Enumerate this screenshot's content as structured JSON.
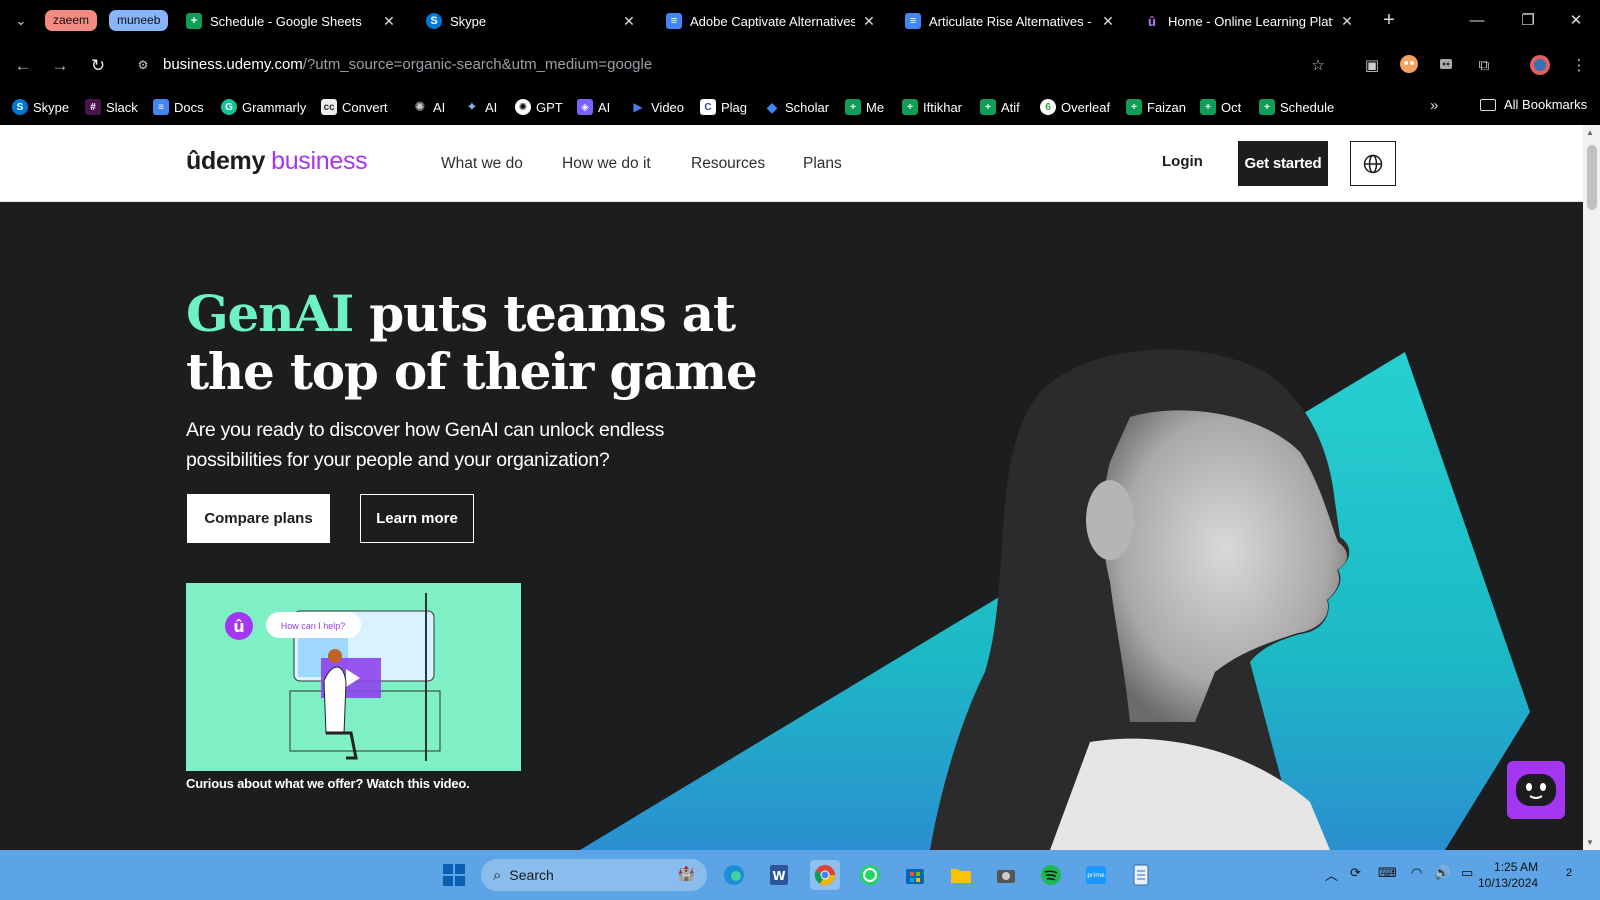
{
  "browser": {
    "tab_groups": [
      {
        "label": "zaeem",
        "color": "#f28b82"
      },
      {
        "label": "muneeb",
        "color": "#8ab4f8"
      }
    ],
    "tabs": [
      {
        "title": "Schedule - Google Sheets",
        "icon": "google-sheets-icon"
      },
      {
        "title": "Skype",
        "icon": "skype-icon"
      },
      {
        "title": "Adobe Captivate Alternatives",
        "icon": "google-docs-icon"
      },
      {
        "title": "Articulate Rise Alternatives - G",
        "icon": "google-docs-icon"
      },
      {
        "title": "Home - Online Learning Platfo",
        "icon": "udemy-icon"
      }
    ],
    "url_host": "business.udemy.com",
    "url_rest": "/?utm_source=organic-search&utm_medium=google",
    "bookmarks": [
      {
        "label": "Skype",
        "icon": "skype-icon"
      },
      {
        "label": "Slack",
        "icon": "slack-icon"
      },
      {
        "label": "Docs",
        "icon": "google-docs-icon"
      },
      {
        "label": "Grammarly",
        "icon": "grammarly-icon"
      },
      {
        "label": "Convert",
        "icon": "convert-icon"
      },
      {
        "label": "AI",
        "icon": "openai-icon"
      },
      {
        "label": "AI",
        "icon": "gemini-icon"
      },
      {
        "label": "GPT",
        "icon": "chatgpt-icon"
      },
      {
        "label": "AI",
        "icon": "ai-assistant-icon"
      },
      {
        "label": "Video",
        "icon": "video-icon"
      },
      {
        "label": "Plag",
        "icon": "plagiarism-icon"
      },
      {
        "label": "Scholar",
        "icon": "google-scholar-icon"
      },
      {
        "label": "Me",
        "icon": "google-sheets-icon"
      },
      {
        "label": "Iftikhar",
        "icon": "google-sheets-icon"
      },
      {
        "label": "Atif",
        "icon": "google-sheets-icon"
      },
      {
        "label": "Overleaf",
        "icon": "overleaf-icon"
      },
      {
        "label": "Faizan",
        "icon": "google-sheets-icon"
      },
      {
        "label": "Oct",
        "icon": "google-sheets-icon"
      },
      {
        "label": "Schedule",
        "icon": "google-sheets-icon"
      }
    ],
    "all_bookmarks": "All Bookmarks"
  },
  "site": {
    "logo_udemy": "ûdemy",
    "logo_business": "business",
    "nav": [
      "What we do",
      "How we do it",
      "Resources",
      "Plans"
    ],
    "login": "Login",
    "get_started": "Get started"
  },
  "hero": {
    "title_accent": "GenAI",
    "title_line1_rest": " puts teams at",
    "title_line2": "the top of their game",
    "subtitle": "Are you ready to discover how GenAI can unlock endless possibilities for your people and your organization?",
    "btn_compare": "Compare plans",
    "btn_learn": "Learn more",
    "video_bubble": "How can I help?",
    "video_caption": "Curious about what we offer? Watch this video."
  },
  "taskbar": {
    "search_label": "Search",
    "time": "1:25 AM",
    "date": "10/13/2024",
    "notification_count": "2"
  },
  "colors": {
    "accent_green": "#6ef2c5",
    "udemy_purple": "#a435f0",
    "teal": "#1cc3c9",
    "dark": "#1c1d1f"
  }
}
